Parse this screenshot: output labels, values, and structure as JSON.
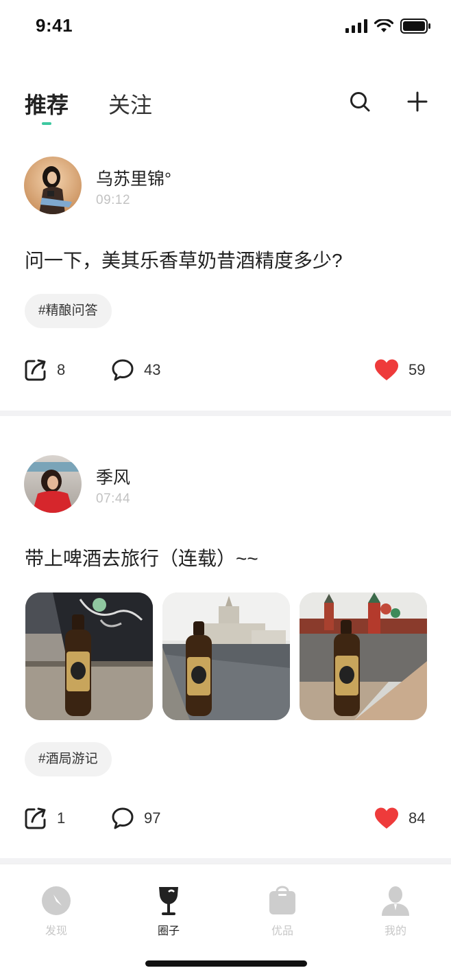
{
  "status_bar": {
    "time": "9:41"
  },
  "header": {
    "tabs": [
      {
        "label": "推荐",
        "active": true
      },
      {
        "label": "关注",
        "active": false
      }
    ],
    "search_icon": "search-icon",
    "add_icon": "plus-icon",
    "accent_color": "#3ec8a0"
  },
  "posts": [
    {
      "username": "乌苏里锦°",
      "time": "09:12",
      "text": "问一下，美其乐香草奶昔酒精度多少?",
      "tag": "#精酿问答",
      "shares": "8",
      "comments": "43",
      "likes": "59"
    },
    {
      "username": "季风",
      "time": "07:44",
      "text": "带上啤酒去旅行（连载）~~",
      "tag": "#酒局游记",
      "shares": "1",
      "comments": "97",
      "likes": "84"
    }
  ],
  "tab_bar": {
    "items": [
      {
        "label": "发现",
        "icon": "compass-icon",
        "active": false
      },
      {
        "label": "圈子",
        "icon": "wine-glass-icon",
        "active": true
      },
      {
        "label": "优品",
        "icon": "shopping-bag-icon",
        "active": false
      },
      {
        "label": "我的",
        "icon": "user-icon",
        "active": false
      }
    ]
  },
  "colors": {
    "like": "#ee3b3b",
    "inactive_tab": "#c7c7c7"
  }
}
